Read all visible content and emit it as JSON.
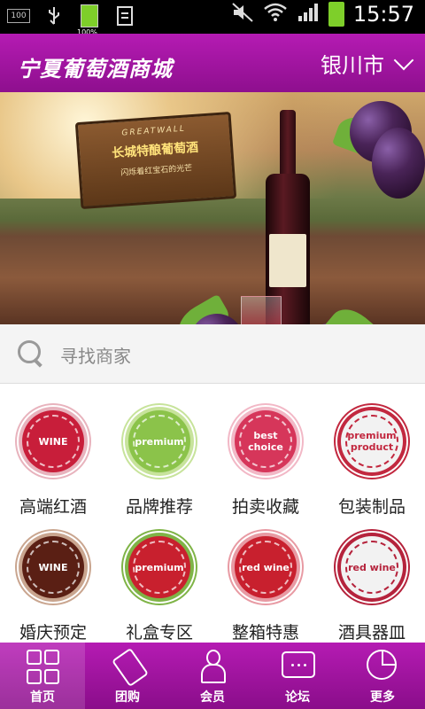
{
  "statusbar": {
    "time": "15:57",
    "battery_small_label": "100%",
    "notification_box": "100",
    "icons": [
      "box-icon",
      "usb-icon",
      "battery-icon",
      "document-icon",
      "mute-icon",
      "wifi-icon",
      "signal-icon",
      "battery-icon"
    ]
  },
  "header": {
    "title": "宁夏葡萄酒商城",
    "city": "银川市"
  },
  "banner": {
    "sign_top": "GREATWALL",
    "sign_main": "长城特酿葡萄酒",
    "sign_sub": "闪烁着红宝石的光芒",
    "slide_count": 8,
    "active_slide_index": 4
  },
  "search": {
    "placeholder": "寻找商家"
  },
  "categories": [
    {
      "label": "高端红酒",
      "badge_text": "WINE",
      "color": "#c81e3a",
      "ring": "#e8b3bd"
    },
    {
      "label": "品牌推荐",
      "badge_text": "premium",
      "color": "#8bc34a",
      "ring": "#c7e39b"
    },
    {
      "label": "拍卖收藏",
      "badge_text": "best choice",
      "color": "#d6365a",
      "ring": "#f2b8c6"
    },
    {
      "label": "包装制品",
      "badge_text": "premium product",
      "color": "#f2f2f2",
      "ring": "#c2283f"
    },
    {
      "label": "婚庆预定",
      "badge_text": "WINE",
      "color": "#5a1f14",
      "ring": "#c9a58f"
    },
    {
      "label": "礼盒专区",
      "badge_text": "premium",
      "color": "#c8202e",
      "ring": "#7fb447"
    },
    {
      "label": "整箱特惠",
      "badge_text": "red wine",
      "color": "#c8202e",
      "ring": "#e89aa3"
    },
    {
      "label": "酒具器皿",
      "badge_text": "red wine",
      "color": "#f2f2f2",
      "ring": "#b5233c"
    }
  ],
  "tabs": [
    {
      "label": "首页",
      "icon": "home-grid-icon",
      "active": true
    },
    {
      "label": "团购",
      "icon": "sale-tag-icon",
      "active": false
    },
    {
      "label": "会员",
      "icon": "user-icon",
      "active": false
    },
    {
      "label": "论坛",
      "icon": "chat-icon",
      "active": false
    },
    {
      "label": "更多",
      "icon": "pie-chart-icon",
      "active": false
    }
  ]
}
